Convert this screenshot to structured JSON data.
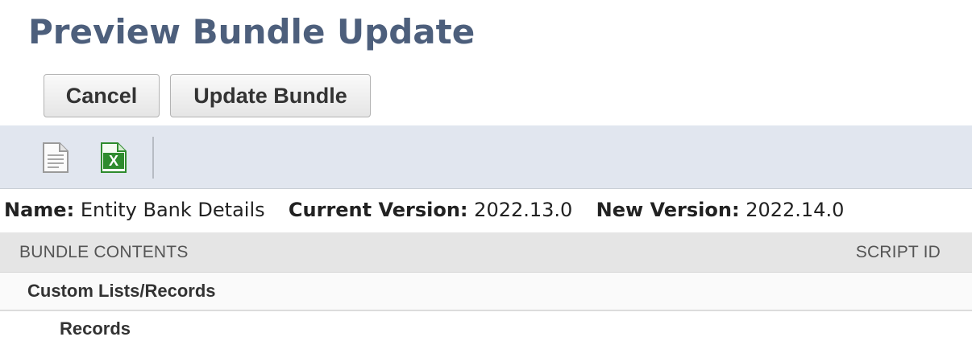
{
  "page": {
    "title": "Preview Bundle Update"
  },
  "actions": {
    "cancel_label": "Cancel",
    "update_label": "Update Bundle"
  },
  "toolbar": {
    "icons": [
      "document-icon",
      "excel-export-icon"
    ],
    "excel_letter": "X"
  },
  "info": {
    "name_label": "Name:",
    "name_value": "Entity Bank Details",
    "current_label": "Current Version:",
    "current_value": "2022.13.0",
    "new_label": "New Version:",
    "new_value": "2022.14.0"
  },
  "table": {
    "headers": {
      "contents": "BUNDLE CONTENTS",
      "script_id": "SCRIPT ID"
    },
    "rows": [
      {
        "label": "Custom Lists/Records",
        "level": 0
      },
      {
        "label": "Records",
        "level": 1
      }
    ]
  },
  "colors": {
    "title": "#4d5f7c",
    "toolbar_bg": "#e1e6ef",
    "header_bg": "#e5e5e5",
    "excel_green": "#2e8b2e"
  }
}
